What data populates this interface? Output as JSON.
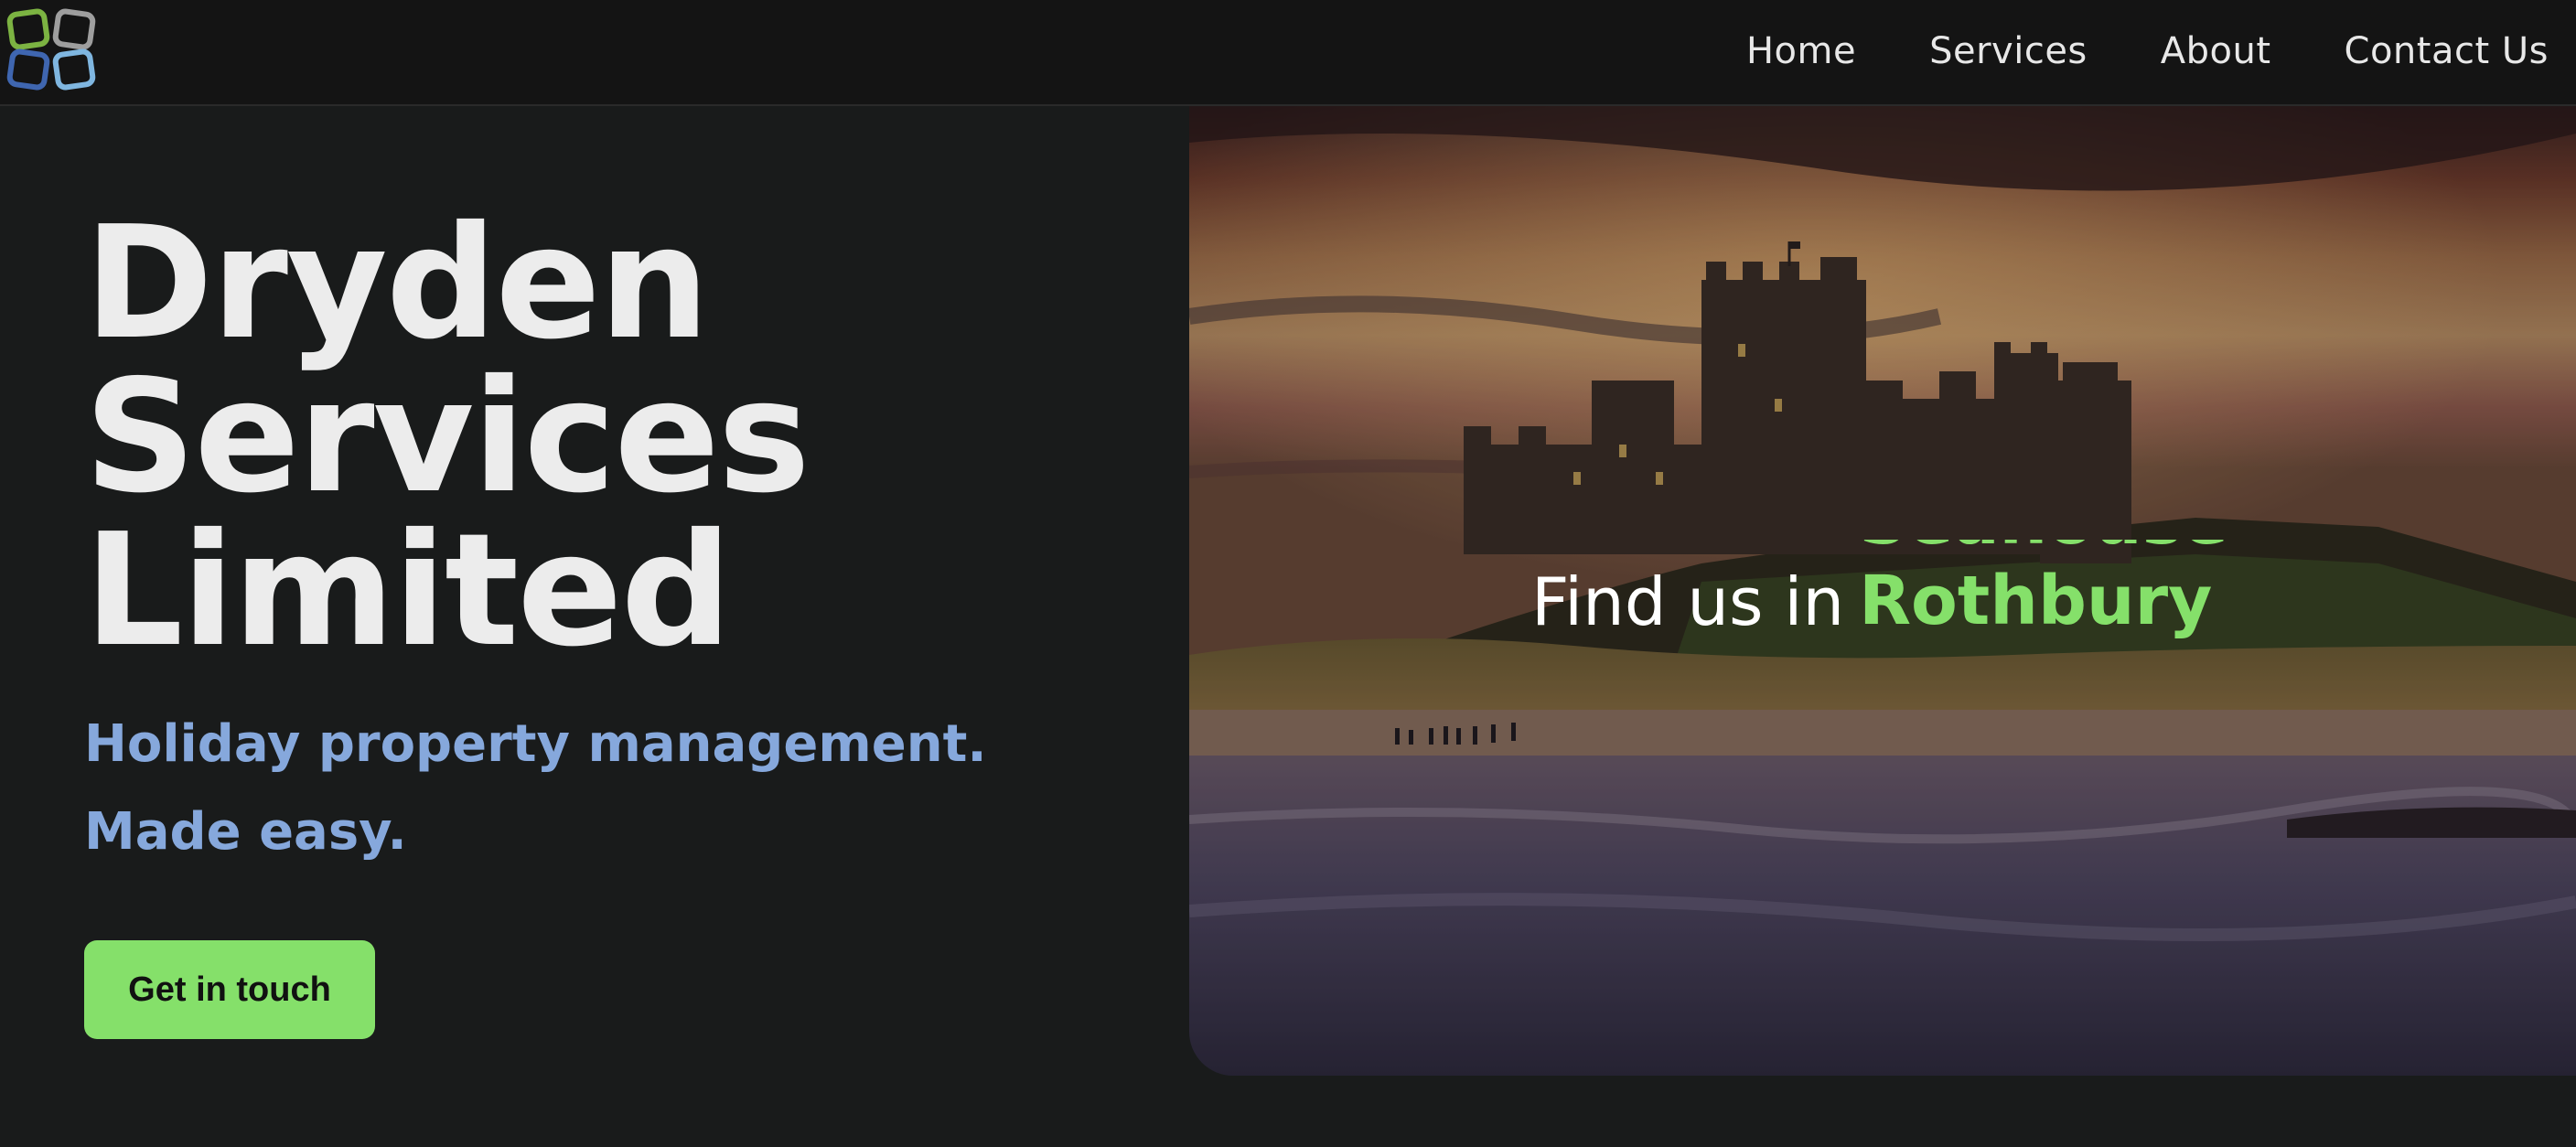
{
  "nav": {
    "logo_alt": "",
    "links": [
      "Home",
      "Services",
      "About",
      "Contact Us"
    ]
  },
  "hero_left": {
    "title_lines": [
      "Dryden",
      "Services",
      "Limited"
    ],
    "tagline_lines": [
      "Holiday property management.",
      "Made easy."
    ],
    "cta_label": "Get in touch"
  },
  "hero_image": {
    "find_label": "Find us in",
    "town_current": "Rothbury",
    "town_previous": "Seahouses"
  },
  "colors": {
    "accent_green": "#85e06a",
    "tagline_blue": "#86a8dc",
    "background": "#191b1b",
    "nav_background": "#141414"
  }
}
